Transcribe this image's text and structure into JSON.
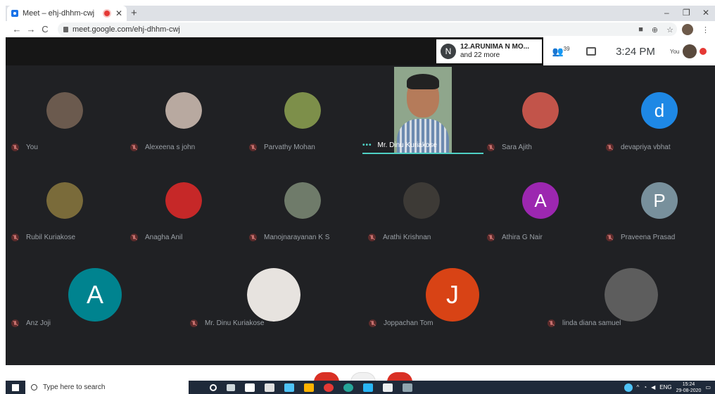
{
  "browser": {
    "tab_title": "Meet – ehj-dhhm-cwj",
    "tab_close": "✕",
    "new_tab": "+",
    "url": "meet.google.com/ehj-dhhm-cwj",
    "win_min": "–",
    "win_max": "❐",
    "win_close": "✕",
    "back": "←",
    "forward": "→",
    "reload": "C"
  },
  "meet": {
    "presenter_initial": "N",
    "presenter_name": "12.ARUNIMA N MO...",
    "presenter_more": "and 22 more",
    "people_count": "39",
    "time": "3:24 PM",
    "you_label": "You",
    "speaker_name": "Mr. Dinu Kuriakose",
    "speaker_dots": "•••",
    "participants": [
      {
        "name": "You",
        "initial": "",
        "color": "#6b5a4e"
      },
      {
        "name": "Alexeena s john",
        "initial": "",
        "color": "#b8a9a0"
      },
      {
        "name": "Parvathy Mohan",
        "initial": "",
        "color": "#7d8f4a"
      },
      {
        "name": "Sara Ajith",
        "initial": "",
        "color": "#c2544a"
      },
      {
        "name": "devapriya vbhat",
        "initial": "d",
        "color": "#1e88e5"
      },
      {
        "name": "Rubil Kuriakose",
        "initial": "",
        "color": "#7a6b3a"
      },
      {
        "name": "Anagha Anil",
        "initial": "",
        "color": "#c62828"
      },
      {
        "name": "Manojnarayanan K S",
        "initial": "",
        "color": "#6f7b6a"
      },
      {
        "name": "Arathi Krishnan",
        "initial": "",
        "color": "#3d3a36"
      },
      {
        "name": "Athira G Nair",
        "initial": "A",
        "color": "#9c27b0"
      },
      {
        "name": "Praveena Prasad",
        "initial": "P",
        "color": "#78909c"
      }
    ],
    "row3": [
      {
        "name": "Anz Joji",
        "initial": "A",
        "color": "#00838f"
      },
      {
        "name": "Mr. Dinu Kuriakose",
        "initial": "",
        "color": "#e7e3df"
      },
      {
        "name": "Joppachan Tom",
        "initial": "J",
        "color": "#d84315"
      },
      {
        "name": "linda diana samuel",
        "initial": "",
        "color": "#5d5d5d"
      }
    ]
  },
  "taskbar": {
    "search_placeholder": "Type here to search",
    "lang": "ENG",
    "clock_time": "15:24",
    "clock_date": "29-08-2020"
  }
}
